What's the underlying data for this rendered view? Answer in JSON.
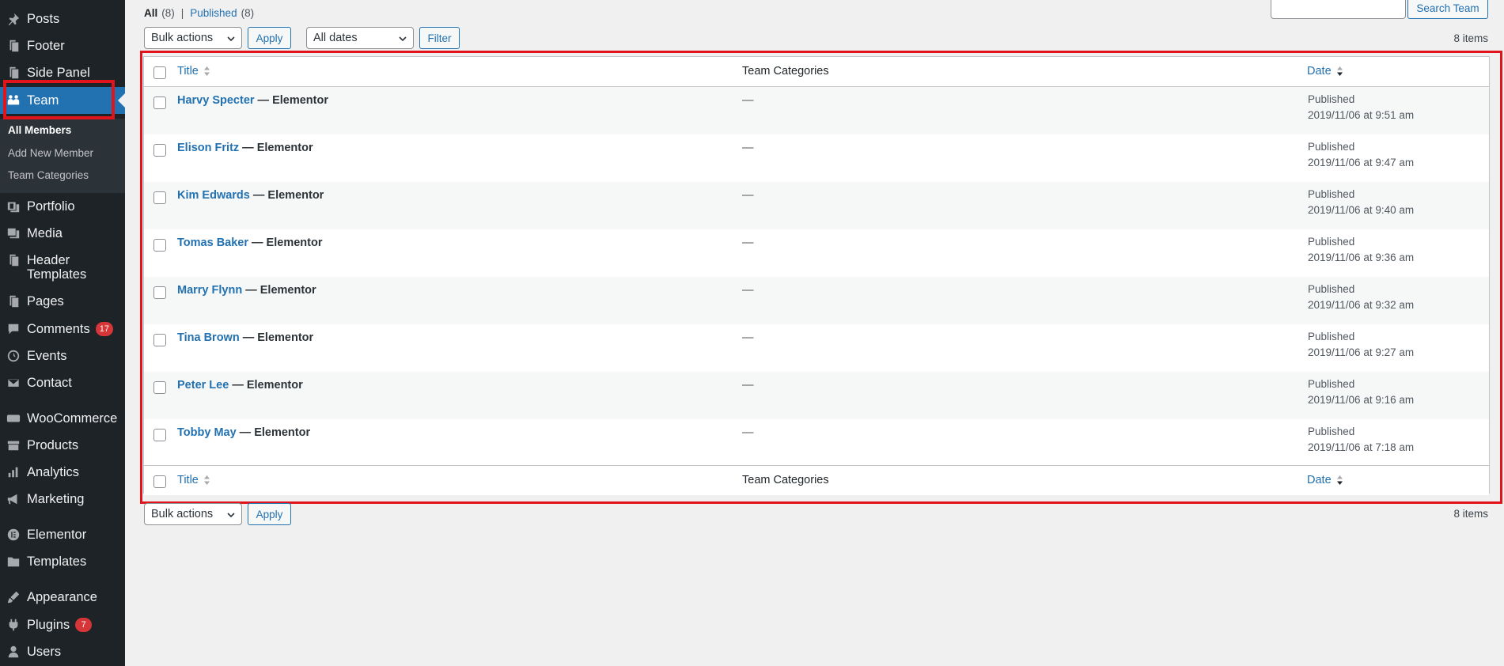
{
  "sidebar": {
    "items": [
      {
        "label": "Posts",
        "icon": "pin-icon"
      },
      {
        "label": "Footer",
        "icon": "page-icon"
      },
      {
        "label": "Side Panel",
        "icon": "page-icon"
      },
      {
        "label": "Team",
        "icon": "team-icon"
      },
      {
        "label": "Portfolio",
        "icon": "portfolio-icon"
      },
      {
        "label": "Media",
        "icon": "media-icon"
      },
      {
        "label": "Header Templates",
        "label_line1": "Header",
        "label_line2": "Templates",
        "icon": "page-icon"
      },
      {
        "label": "Pages",
        "icon": "page-icon"
      },
      {
        "label": "Comments",
        "icon": "comment-icon",
        "badge": "17"
      },
      {
        "label": "Events",
        "icon": "events-icon"
      },
      {
        "label": "Contact",
        "icon": "mail-icon"
      },
      {
        "label": "WooCommerce",
        "icon": "woo-icon"
      },
      {
        "label": "Products",
        "icon": "products-icon"
      },
      {
        "label": "Analytics",
        "icon": "analytics-icon"
      },
      {
        "label": "Marketing",
        "icon": "megaphone-icon"
      },
      {
        "label": "Elementor",
        "icon": "elementor-icon"
      },
      {
        "label": "Templates",
        "icon": "folder-icon"
      },
      {
        "label": "Appearance",
        "icon": "brush-icon"
      },
      {
        "label": "Plugins",
        "icon": "plugin-icon",
        "badge": "7"
      },
      {
        "label": "Users",
        "icon": "user-icon"
      }
    ],
    "submenu": [
      "All Members",
      "Add New Member",
      "Team Categories"
    ]
  },
  "views": {
    "all_label": "All",
    "all_count": "(8)",
    "separator": "|",
    "published_label": "Published",
    "published_count": "(8)"
  },
  "search": {
    "button_label": "Search Team",
    "value": ""
  },
  "top_nav": {
    "bulk_actions": "Bulk actions",
    "apply": "Apply",
    "dates": "All dates",
    "filter": "Filter",
    "items_count": "8 items"
  },
  "bottom_nav": {
    "bulk_actions": "Bulk actions",
    "apply": "Apply",
    "items_count": "8 items"
  },
  "table": {
    "columns": {
      "title": "Title",
      "categories": "Team Categories",
      "date": "Date"
    },
    "rows": [
      {
        "name": "Harvy Specter",
        "suffix": " — Elementor",
        "category": "—",
        "status": "Published",
        "datetime": "2019/11/06 at 9:51 am"
      },
      {
        "name": "Elison Fritz",
        "suffix": " — Elementor",
        "category": "—",
        "status": "Published",
        "datetime": "2019/11/06 at 9:47 am"
      },
      {
        "name": "Kim Edwards",
        "suffix": " — Elementor",
        "category": "—",
        "status": "Published",
        "datetime": "2019/11/06 at 9:40 am"
      },
      {
        "name": "Tomas Baker",
        "suffix": " — Elementor",
        "category": "—",
        "status": "Published",
        "datetime": "2019/11/06 at 9:36 am"
      },
      {
        "name": "Marry Flynn",
        "suffix": " — Elementor",
        "category": "—",
        "status": "Published",
        "datetime": "2019/11/06 at 9:32 am"
      },
      {
        "name": "Tina Brown",
        "suffix": " — Elementor",
        "category": "—",
        "status": "Published",
        "datetime": "2019/11/06 at 9:27 am"
      },
      {
        "name": "Peter Lee",
        "suffix": " — Elementor",
        "category": "—",
        "status": "Published",
        "datetime": "2019/11/06 at 9:16 am"
      },
      {
        "name": "Tobby May",
        "suffix": " — Elementor",
        "category": "—",
        "status": "Published",
        "datetime": "2019/11/06 at 7:18 am"
      }
    ]
  },
  "colors": {
    "accent": "#2271b1",
    "sidebar_bg": "#1d2327",
    "highlight": "#e2141b",
    "badge": "#d63638"
  }
}
